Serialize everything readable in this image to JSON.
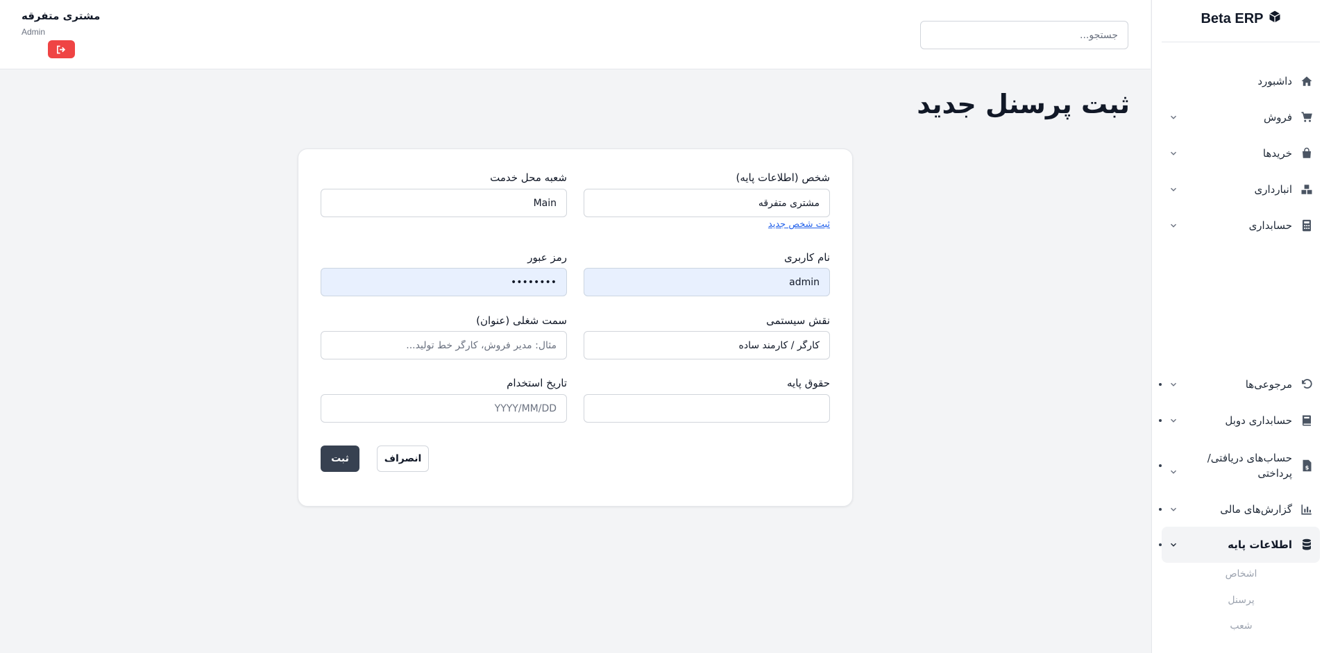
{
  "sidebar": {
    "brand": "Beta ERP",
    "items": [
      {
        "label": "داشبورد"
      },
      {
        "label": "فروش"
      },
      {
        "label": "خریدها"
      },
      {
        "label": "انبارداری"
      },
      {
        "label": "حسابداری"
      },
      {
        "label": "مرجوعی‌ها"
      },
      {
        "label": "حسابداری دوبل"
      },
      {
        "label": "حساب‌های دریافتی/ پرداختی"
      },
      {
        "label": "گزارش‌های مالی"
      },
      {
        "label": "اطلاعات پایه"
      }
    ],
    "sub_items": [
      {
        "label": "اشخاص"
      },
      {
        "label": "پرسنل"
      },
      {
        "label": "شعب"
      }
    ]
  },
  "header": {
    "search_placeholder": "جستجو...",
    "user_name": "مشتری متفرقه",
    "user_role": "Admin"
  },
  "page": {
    "title": "ثبت پرسنل جدید"
  },
  "form": {
    "person_label": "شخص (اطلاعات پایه)",
    "person_value": "مشتری متفرقه",
    "new_person_link": "ثبت شخص جدید",
    "branch_label": "شعبه محل خدمت",
    "branch_value": "Main",
    "username_label": "نام کاربری",
    "username_value": "admin",
    "password_label": "رمز عبور",
    "password_value": "••••••••",
    "role_label": "نقش سیستمی",
    "role_value": "کارگر / کارمند ساده",
    "job_title_label": "سمت شغلی (عنوان)",
    "job_title_placeholder": "مثال: مدیر فروش، کارگر خط تولید...",
    "salary_label": "حقوق پایه",
    "salary_value": "",
    "hire_date_label": "تاریخ استخدام",
    "hire_date_placeholder": "YYYY/MM/DD",
    "submit_label": "ثبت",
    "cancel_label": "انصراف"
  },
  "colors": {
    "primary_button": "#374151",
    "logout_button": "#ef4444",
    "link": "#2563eb",
    "autofill_bg": "#e8f0fe"
  },
  "icons": {
    "brand": "cube-icon",
    "dashboard": "home-icon",
    "sales": "cart-icon",
    "purchases": "bag-icon",
    "inventory": "boxes-icon",
    "accounting": "calculator-icon",
    "returns": "undo-icon",
    "double_entry": "book-icon",
    "receivables": "invoice-dollar-icon",
    "reports": "bar-chart-icon",
    "basic_info": "database-icon",
    "logout": "sign-out-icon"
  }
}
